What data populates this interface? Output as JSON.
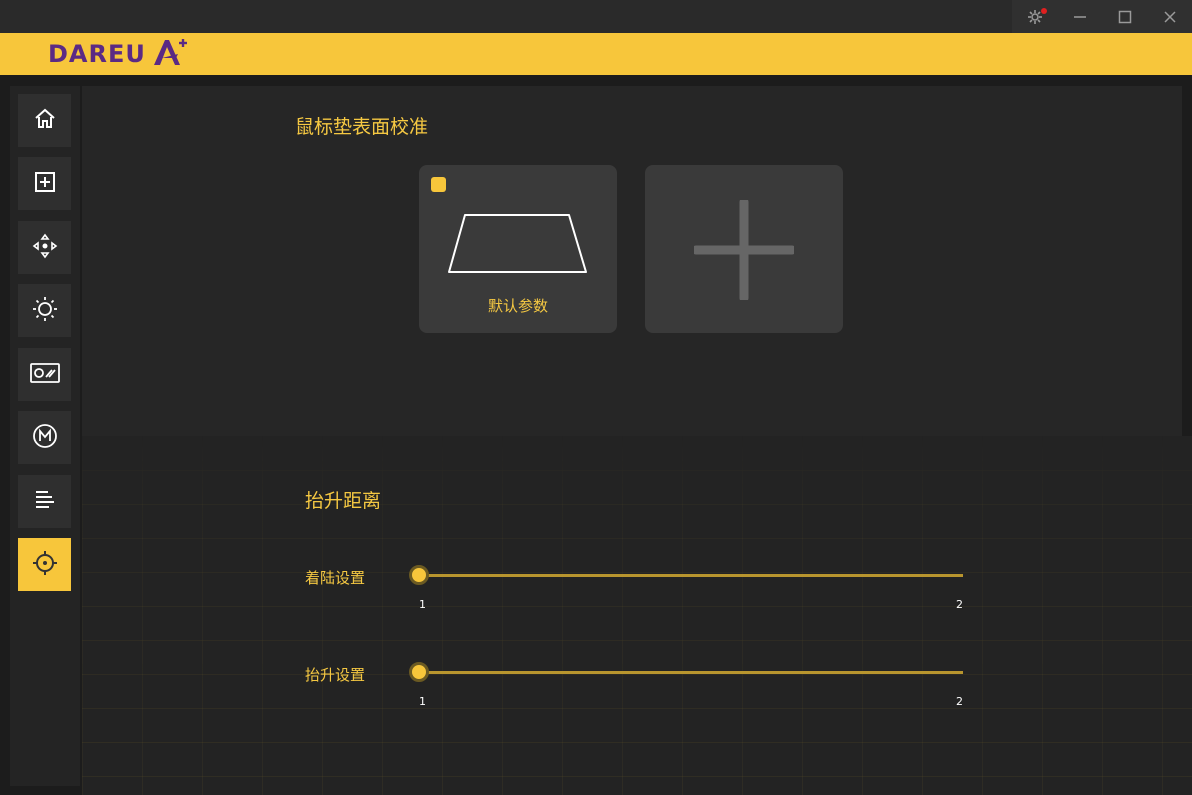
{
  "window": {
    "controls": [
      {
        "name": "settings-icon"
      },
      {
        "name": "minimize-icon"
      },
      {
        "name": "maximize-icon"
      },
      {
        "name": "close-icon"
      }
    ]
  },
  "brand": {
    "logo_text": "DAREU",
    "logo_mark": "A+"
  },
  "sidebar": {
    "items": [
      {
        "icon": "home-icon"
      },
      {
        "icon": "add-square-icon"
      },
      {
        "icon": "move-arrows-icon"
      },
      {
        "icon": "light-sun-icon"
      },
      {
        "icon": "performance-icon"
      },
      {
        "icon": "macro-m-icon"
      },
      {
        "icon": "text-list-icon"
      },
      {
        "icon": "crosshair-icon",
        "active": true
      }
    ]
  },
  "calibration": {
    "title": "鼠标垫表面校准",
    "default_card_label": "默认参数"
  },
  "lift": {
    "title": "抬升距离",
    "landing": {
      "label": "着陆设置",
      "min": "1",
      "max": "2",
      "value": 1
    },
    "lift_setting": {
      "label": "抬升设置",
      "min": "1",
      "max": "2",
      "value": 1
    }
  },
  "colors": {
    "accent": "#f7c63b",
    "brand_purple": "#5b2a84",
    "background": "#262626"
  }
}
